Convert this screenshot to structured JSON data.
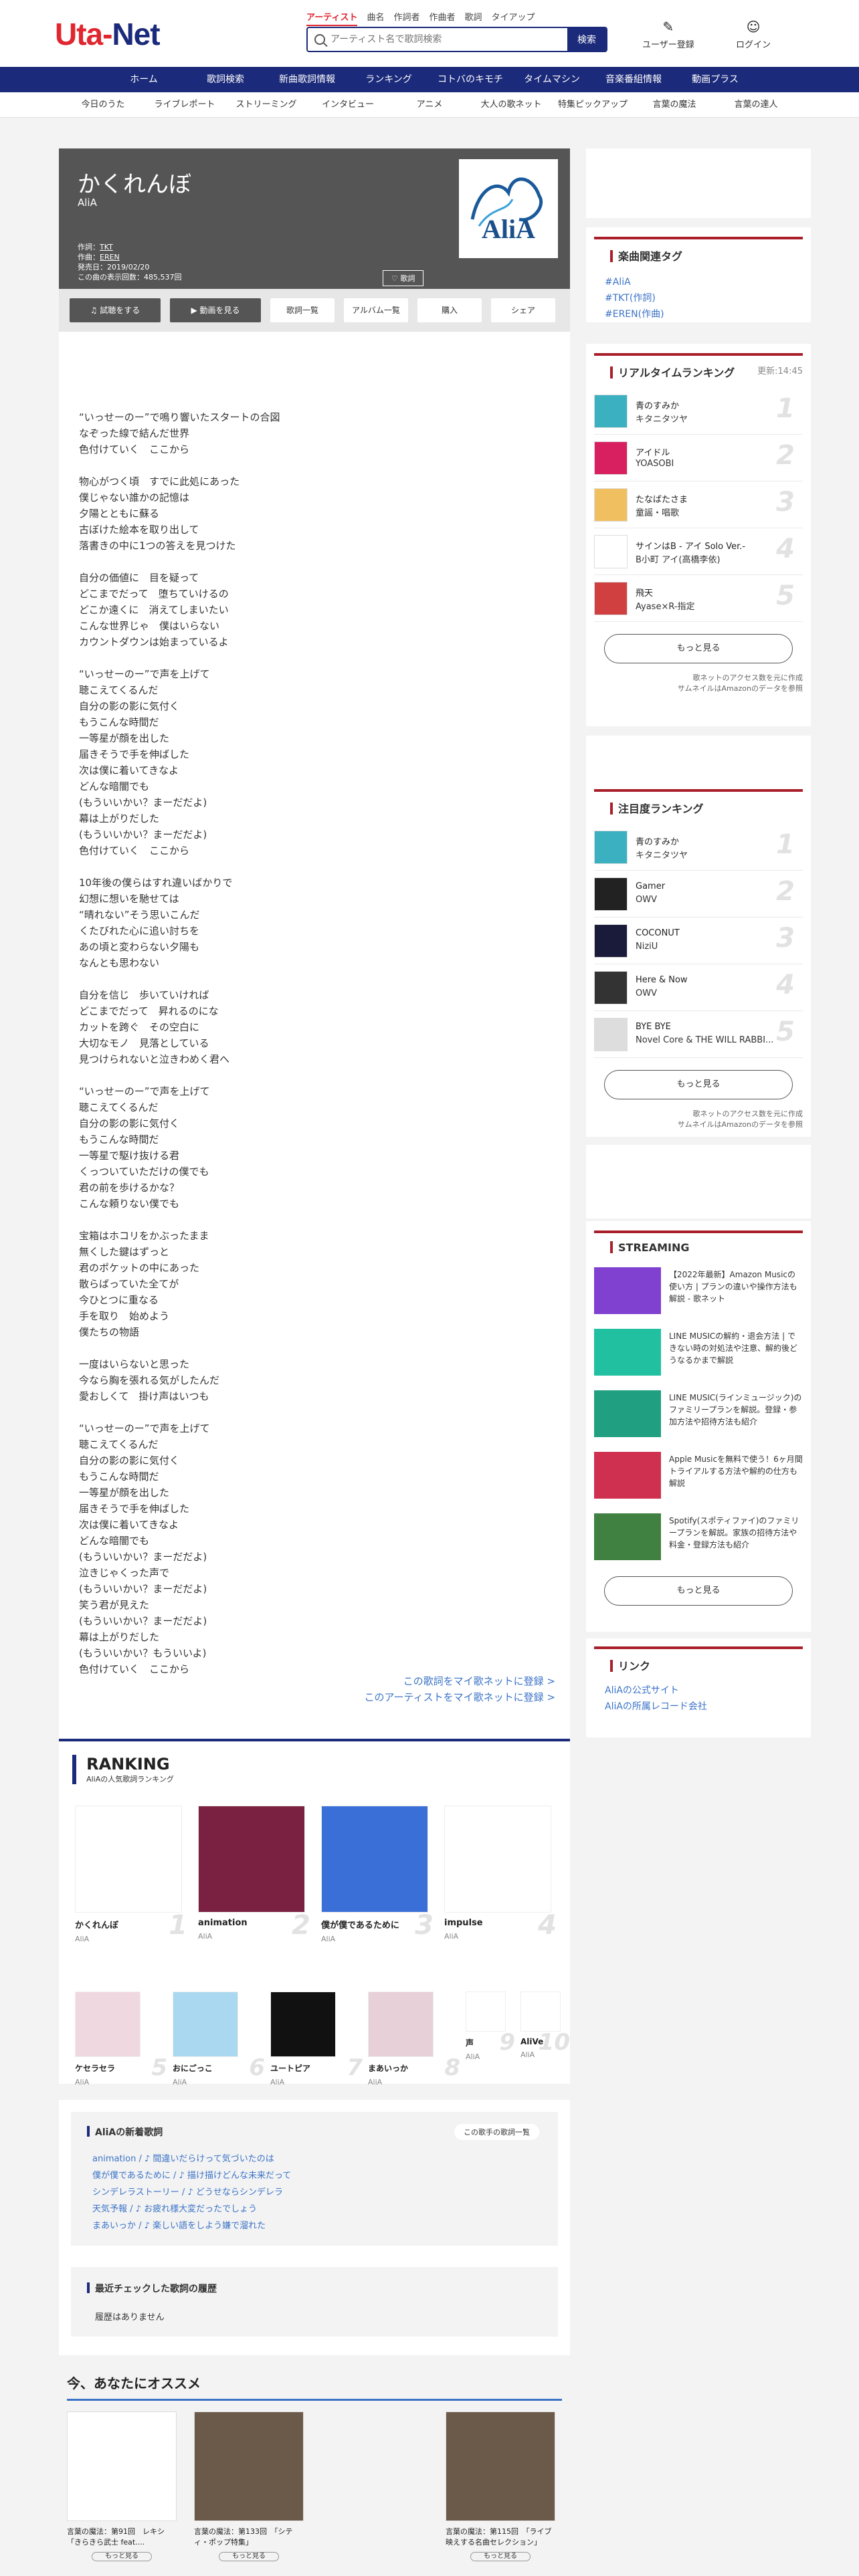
{
  "site": {
    "logo_part1": "Uta-",
    "logo_part2": "Net"
  },
  "search": {
    "tabs": [
      "アーティスト",
      "曲名",
      "作詞者",
      "作曲者",
      "歌詞",
      "タイアップ"
    ],
    "placeholder": "アーティスト名で歌詞検索",
    "button": "検索"
  },
  "header": {
    "register": "ユーザー登録",
    "login": "ログイン"
  },
  "main_nav": [
    "ホーム",
    "歌詞検索",
    "新曲歌詞情報",
    "ランキング",
    "コトバのキモチ",
    "タイムマシン",
    "音楽番組情報",
    "動画プラス"
  ],
  "sub_nav": [
    "今日のうた",
    "ライブレポート",
    "ストリーミング",
    "インタビュー",
    "アニメ",
    "大人の歌ネット",
    "特集ピックアップ",
    "言葉の魔法",
    "言葉の達人"
  ],
  "song": {
    "title": "かくれんぼ",
    "artist": "AliA",
    "lyricist_label": "作詞：",
    "lyricist": "TKT",
    "composer_label": "作曲：",
    "composer": "EREN",
    "release": "発売日：2019/02/20",
    "views": "この曲の表示回数：485,537回",
    "fav": "♡ 歌詞",
    "jacket_text": "AliA"
  },
  "actions": {
    "listen": "♫ 試聴をする",
    "video": "▶ 動画を見る",
    "list": "歌詞一覧",
    "album": "アルバム一覧",
    "buy": "購入",
    "share": "シェア"
  },
  "lyrics": [
    [
      "“いっせーのー”で鳴り響いたスタートの合図",
      "なぞった線で結んだ世界",
      "色付けていく　ここから"
    ],
    [
      "物心がつく頃　すでに此処にあった",
      "僕じゃない誰かの記憶は",
      "夕陽とともに蘇る",
      "古ぼけた絵本を取り出して",
      "落書きの中に1つの答えを見つけた"
    ],
    [
      "自分の価値に　目を疑って",
      "どこまでだって　堕ちていけるの",
      "どこか遠くに　消えてしまいたい",
      "こんな世界じゃ　僕はいらない",
      "カウントダウンは始まっているよ"
    ],
    [
      "“いっせーのー”で声を上げて",
      "聴こえてくるんだ",
      "自分の影の影に気付く",
      "もうこんな時間だ",
      "一等星が顔を出した",
      "届きそうで手を伸ばした",
      "次は僕に着いてきなよ",
      "どんな暗闇でも",
      "(もういいかい？まーだだよ)",
      "幕は上がりだした",
      "(もういいかい？まーだだよ)",
      "色付けていく　ここから"
    ],
    [
      "10年後の僕らはすれ違いばかりで",
      "幻想に想いを馳せては",
      "“晴れない”そう思いこんだ",
      "くたびれた心に追い討ちを",
      "あの頃と変わらない夕陽も",
      "なんとも思わない"
    ],
    [
      "自分を信じ　歩いていければ",
      "どこまでだって　昇れるのにな",
      "カットを跨ぐ　その空白に",
      "大切なモノ　見落としている",
      "見つけられないと泣きわめく君へ"
    ],
    [
      "“いっせーのー”で声を上げて",
      "聴こえてくるんだ",
      "自分の影の影に気付く",
      "もうこんな時間だ",
      "一等星で駆け抜ける君",
      "くっついていただけの僕でも",
      "君の前を歩けるかな？",
      "こんな頼りない僕でも"
    ],
    [
      "宝箱はホコリをかぶったまま",
      "無くした鍵はずっと",
      "君のポケットの中にあった",
      "散らばっていた全てが",
      "今ひとつに重なる",
      "手を取り　始めよう",
      "僕たちの物語"
    ],
    [
      "一度はいらないと思った",
      "今なら胸を張れる気がしたんだ",
      "愛おしくて　掛け声はいつも"
    ],
    [
      "“いっせーのー”で声を上げて",
      "聴こえてくるんだ",
      "自分の影の影に気付く",
      "もうこんな時間だ",
      "一等星が顔を出した",
      "届きそうで手を伸ばした",
      "次は僕に着いてきなよ",
      "どんな暗闇でも",
      "(もういいかい？まーだだよ)",
      "泣きじゃくった声で",
      "(もういいかい？まーだだよ)",
      "笑う君が見えた",
      "(もういいかい？まーだだよ)",
      "幕は上がりだした",
      "(もういいかい？もういいよ)",
      "色付けていく　ここから"
    ]
  ],
  "my_links": [
    "この歌詞をマイ歌ネットに登録 >",
    "このアーティストをマイ歌ネットに登録 >"
  ],
  "ranking": {
    "title": "RANKING",
    "subtitle": "AliAの人気歌詞ランキング",
    "items": [
      {
        "n": "1",
        "title": "かくれんぼ",
        "artist": "AliA"
      },
      {
        "n": "2",
        "title": "animation",
        "artist": "AliA"
      },
      {
        "n": "3",
        "title": "僕が僕であるために",
        "artist": "AliA"
      },
      {
        "n": "4",
        "title": "impulse",
        "artist": "AliA"
      },
      {
        "n": "5",
        "title": "ケセラセラ",
        "artist": "AliA"
      },
      {
        "n": "6",
        "title": "おにごっこ",
        "artist": "AliA"
      },
      {
        "n": "7",
        "title": "ユートピア",
        "artist": "AliA"
      },
      {
        "n": "8",
        "title": "まあいっか",
        "artist": "AliA"
      },
      {
        "n": "9",
        "title": "声",
        "artist": "AliA"
      },
      {
        "n": "10",
        "title": "AliVe",
        "artist": "AliA"
      }
    ]
  },
  "new_lyrics": {
    "title": "AliAの新着歌詞",
    "button": "この歌手の歌詞一覧",
    "items": [
      "animation / ♪ 間違いだらけって気づいたのは",
      "僕が僕であるために / ♪ 描け描けどんな未来だって",
      "シンデレラストーリー / ♪ どうせならシンデレラ",
      "天気予報 / ♪ お疲れ様大変だったでしょう",
      "まあいっか / ♪ 楽しい語をしよう嫌で溜れた"
    ]
  },
  "history": {
    "title": "最近チェックした歌詞の履歴",
    "empty": "履歴はありません"
  },
  "recommend": {
    "title": "今、あなたにオススメ",
    "items": [
      {
        "text": "言葉の魔法：第91回　レキシ「きらきら武士 feat....",
        "btn": "もっと見る"
      },
      {
        "text": "言葉の魔法：第133回　「シティ・ポップ特集」",
        "btn": "もっと見る"
      },
      {
        "text": "言葉の魔法：第115回　「ライブ映えする名曲セレクション」",
        "btn": "もっと見る"
      }
    ]
  },
  "side": {
    "tags_title": "楽曲関連タグ",
    "tags": [
      "#AliA",
      "#TKT(作詞)",
      "#EREN(作曲)"
    ],
    "rt_title": "リアルタイムランキング",
    "rt_update": "更新:14:45",
    "rt": [
      {
        "n": "1",
        "t": "青のすみか",
        "a": "キタニタツヤ"
      },
      {
        "n": "2",
        "t": "アイドル",
        "a": "YOASOBI"
      },
      {
        "n": "3",
        "t": "たなばたさま",
        "a": "童謡・唱歌"
      },
      {
        "n": "4",
        "t": "サインはB - アイ Solo Ver.-",
        "a": "B小町 アイ(高橋李依)"
      },
      {
        "n": "5",
        "t": "飛天",
        "a": "Ayase×R-指定"
      }
    ],
    "more": "もっと見る",
    "note1": "歌ネットのアクセス数を元に作成",
    "note2": "サムネイルはAmazonのデータを参照",
    "att_title": "注目度ランキング",
    "att": [
      {
        "n": "1",
        "t": "青のすみか",
        "a": "キタニタツヤ"
      },
      {
        "n": "2",
        "t": "Gamer",
        "a": "OWV"
      },
      {
        "n": "3",
        "t": "COCONUT",
        "a": "NiziU"
      },
      {
        "n": "4",
        "t": "Here & Now",
        "a": "OWV"
      },
      {
        "n": "5",
        "t": "BYE BYE",
        "a": "Novel Core & THE WILL RABBI..."
      }
    ],
    "st_title": "STREAMING",
    "st": [
      "【2022年最新】Amazon Musicの使い方 | プランの違いや操作方法も解説 - 歌ネット",
      "LINE MUSICの解約・退会方法 | できない時の対処法や注意、解約後どうなるかまで解説",
      "LINE MUSIC(ラインミュージック)のファミリープランを解説。登録・参加方法や招待方法も紹介",
      "Apple Musicを無料で使う！6ヶ月間トライアルする方法や解約の仕方も解説",
      "Spotify(スポティファイ)のファミリープランを解説。家族の招待方法や料金・登録方法も紹介"
    ],
    "link_title": "リンク",
    "links": [
      "AliAの公式サイト",
      "AliAの所属レコード会社"
    ]
  },
  "colors": {
    "brand_red": "#e0262f",
    "brand_navy": "#1b2a7a",
    "side_red": "#a81f2a",
    "link_blue": "#3b73c7"
  }
}
